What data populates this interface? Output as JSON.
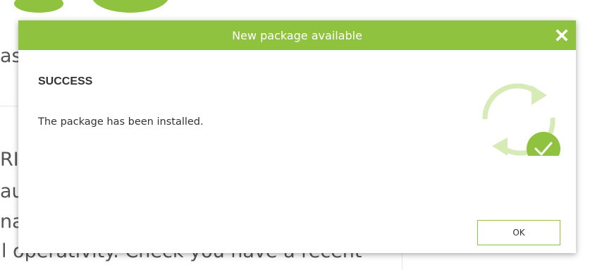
{
  "background": {
    "text_lines": [
      "as",
      "RI",
      "au",
      "na",
      "l operativity. Check you have a recent"
    ]
  },
  "modal": {
    "title": "New package available",
    "status_heading": "SUCCESS",
    "status_message": "The package has been installed.",
    "ok_label": "OK",
    "icons": {
      "close": "close-icon",
      "status": "sync-success-icon"
    }
  },
  "colors": {
    "accent": "#8ec23f",
    "accent_light": "#d6ebb5",
    "text": "#333333"
  }
}
